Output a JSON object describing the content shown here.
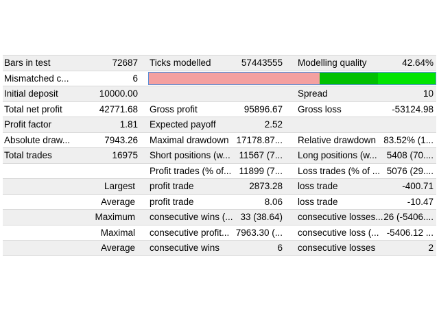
{
  "rows": [
    {
      "c1": "Bars in test",
      "c2": "72687",
      "c3": "Ticks modelled",
      "c4": "57443555",
      "c5": "Modelling quality",
      "c6": "42.64%"
    },
    {
      "c1": "Mismatched c...",
      "c2": "6"
    },
    {
      "c1": "Initial deposit",
      "c2": "10000.00",
      "c5": "Spread",
      "c6": "10"
    },
    {
      "c1": "Total net profit",
      "c2": "42771.68",
      "c3": "Gross profit",
      "c4": "95896.67",
      "c5": "Gross loss",
      "c6": "-53124.98"
    },
    {
      "c1": "Profit factor",
      "c2": "1.81",
      "c3": "Expected payoff",
      "c4": "2.52"
    },
    {
      "c1": "Absolute draw...",
      "c2": "7943.26",
      "c3": "Maximal drawdown",
      "c4": "17178.87...",
      "c5": "Relative drawdown",
      "c6": "83.52% (1..."
    },
    {
      "c1": "Total trades",
      "c2": "16975",
      "c3": "Short positions (w...",
      "c4": "11567 (7...",
      "c5": "Long positions (w...",
      "c6": "5408 (70...."
    },
    {
      "c3": "Profit trades (% of...",
      "c4": "11899 (7...",
      "c5": "Loss trades (% of ...",
      "c6": "5076 (29...."
    },
    {
      "c1": "Largest",
      "c3": "profit trade",
      "c4": "2873.28",
      "c5": "loss trade",
      "c6": "-400.71"
    },
    {
      "c1": "Average",
      "c3": "profit trade",
      "c4": "8.06",
      "c5": "loss trade",
      "c6": "-10.47"
    },
    {
      "c1": "Maximum",
      "c3": "consecutive wins (...",
      "c4": "33 (38.64)",
      "c5": "consecutive losses...",
      "c6": "26 (-5406...."
    },
    {
      "c1": "Maximal",
      "c3": "consecutive profit...",
      "c4": "7963.30 (...",
      "c5": "consecutive loss (...",
      "c6": "-5406.12 ..."
    },
    {
      "c1": "Average",
      "c3": "consecutive wins",
      "c4": "6",
      "c5": "consecutive losses",
      "c6": "2"
    }
  ],
  "modelling_quality_bar": {
    "segments": [
      {
        "color": "#f4a0a0",
        "fraction": 0.595
      },
      {
        "color": "#00c000",
        "fraction": 0.205
      },
      {
        "color": "#00e400",
        "fraction": 0.2
      }
    ]
  }
}
